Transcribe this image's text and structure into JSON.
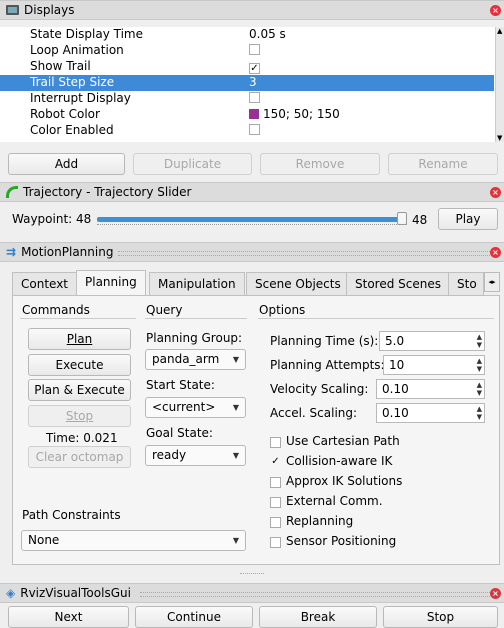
{
  "displays": {
    "title": "Displays",
    "props": [
      {
        "k": "State Display Time",
        "v": "0.05 s",
        "type": "text"
      },
      {
        "k": "Loop Animation",
        "v": "",
        "type": "check",
        "checked": false
      },
      {
        "k": "Show Trail",
        "v": "",
        "type": "check",
        "checked": true
      },
      {
        "k": "Trail Step Size",
        "v": "3",
        "type": "text",
        "selected": true
      },
      {
        "k": "Interrupt Display",
        "v": "",
        "type": "check",
        "checked": false
      },
      {
        "k": "Robot Color",
        "v": "150; 50; 150",
        "type": "color",
        "color": "#963296"
      },
      {
        "k": "Color Enabled",
        "v": "",
        "type": "check",
        "checked": false
      }
    ],
    "buttons": {
      "add": "Add",
      "duplicate": "Duplicate",
      "remove": "Remove",
      "rename": "Rename"
    }
  },
  "trajectory": {
    "title": "Trajectory - Trajectory Slider",
    "waypoint_label": "Waypoint: 48",
    "max_value": "48",
    "play": "Play",
    "fraction": 1.0
  },
  "motion": {
    "title": "MotionPlanning",
    "tabs": [
      "Context",
      "Planning",
      "Manipulation",
      "Scene Objects",
      "Stored Scenes",
      "Sto"
    ],
    "commands": {
      "header": "Commands",
      "plan": "Plan",
      "execute": "Execute",
      "plan_execute": "Plan & Execute",
      "stop": "Stop",
      "time": "Time: 0.021",
      "clear": "Clear octomap"
    },
    "query": {
      "header": "Query",
      "group_label": "Planning Group:",
      "group": "panda_arm",
      "start_label": "Start State:",
      "start": "<current>",
      "goal_label": "Goal State:",
      "goal": "ready"
    },
    "options": {
      "header": "Options",
      "time_label": "Planning Time (s):",
      "time": "5.0",
      "attempts_label": "Planning Attempts:",
      "attempts": "10",
      "vel_label": "Velocity Scaling:",
      "vel": "0.10",
      "acc_label": "Accel. Scaling:",
      "acc": "0.10",
      "checks": [
        {
          "label": "Use Cartesian Path",
          "checked": false
        },
        {
          "label": "Collision-aware IK",
          "checked": true
        },
        {
          "label": "Approx IK Solutions",
          "checked": false
        },
        {
          "label": "External Comm.",
          "checked": false
        },
        {
          "label": "Replanning",
          "checked": false
        },
        {
          "label": "Sensor Positioning",
          "checked": false
        }
      ]
    },
    "constraints": {
      "header": "Path Constraints",
      "value": "None"
    }
  },
  "rviz": {
    "title": "RvizVisualToolsGui",
    "next": "Next",
    "continue": "Continue",
    "break": "Break",
    "stop": "Stop"
  }
}
